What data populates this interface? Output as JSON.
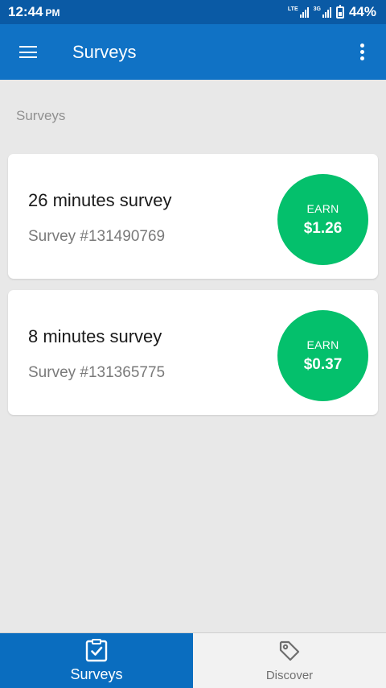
{
  "status_bar": {
    "time": "12:44",
    "ampm": "PM",
    "network_1": "LTE",
    "network_2": "3G",
    "battery": "44%"
  },
  "app_bar": {
    "title": "Surveys",
    "menu_icon": "hamburger-menu-icon",
    "overflow_icon": "more-vert-icon"
  },
  "section_label": "Surveys",
  "surveys": [
    {
      "title": "26 minutes survey",
      "id": "Survey #131490769",
      "earn_label": "EARN",
      "amount": "$1.26"
    },
    {
      "title": "8 minutes survey",
      "id": "Survey #131365775",
      "earn_label": "EARN",
      "amount": "$0.37"
    }
  ],
  "bottom_nav": [
    {
      "label": "Surveys",
      "icon": "clipboard-check-icon",
      "active": true
    },
    {
      "label": "Discover",
      "icon": "tag-icon",
      "active": false
    }
  ],
  "colors": {
    "status_bar": "#0a5aa5",
    "app_bar": "#1072c5",
    "earn_badge": "#04c06c",
    "nav_active": "#0a6dbf",
    "background": "#e8e8e8"
  }
}
